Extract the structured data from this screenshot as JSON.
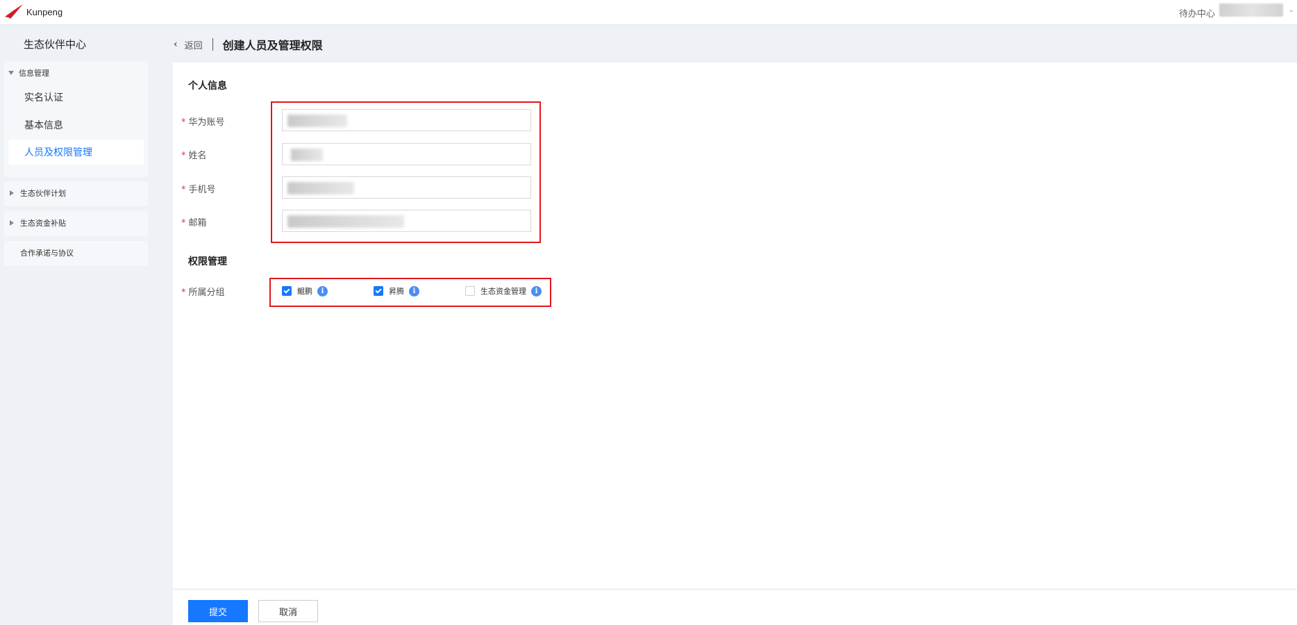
{
  "brand": {
    "name": "Kunpeng"
  },
  "header": {
    "todo_label": "待办中心"
  },
  "sidebar": {
    "title": "生态伙伴中心",
    "groups": [
      {
        "label": "信息管理",
        "expanded": true,
        "items": [
          {
            "label": "实名认证"
          },
          {
            "label": "基本信息"
          },
          {
            "label": "人员及权限管理",
            "active": true
          }
        ]
      },
      {
        "label": "生态伙伴计划",
        "expanded": false
      },
      {
        "label": "生态资金补贴",
        "expanded": false
      },
      {
        "label": "合作承诺与协议"
      }
    ]
  },
  "breadcrumb": {
    "back_label": "返回",
    "title": "创建人员及管理权限"
  },
  "form": {
    "personal_section": "个人信息",
    "fields": [
      {
        "label": "华为账号",
        "required": true
      },
      {
        "label": "姓名",
        "required": true
      },
      {
        "label": "手机号",
        "required": true
      },
      {
        "label": "邮箱",
        "required": true
      }
    ],
    "permission_section": "权限管理",
    "group_label": "所属分组",
    "groups": [
      {
        "label": "鲲鹏",
        "checked": true,
        "info_icon": "info-icon"
      },
      {
        "label": "昇腾",
        "checked": true,
        "info_icon": "info-icon"
      },
      {
        "label": "生态资金管理",
        "checked": false,
        "info_icon": "info-icon"
      }
    ]
  },
  "footer": {
    "submit_label": "提交",
    "cancel_label": "取消"
  },
  "colors": {
    "primary": "#1677ff",
    "highlight": "#e3151a",
    "required": "#e53935"
  }
}
